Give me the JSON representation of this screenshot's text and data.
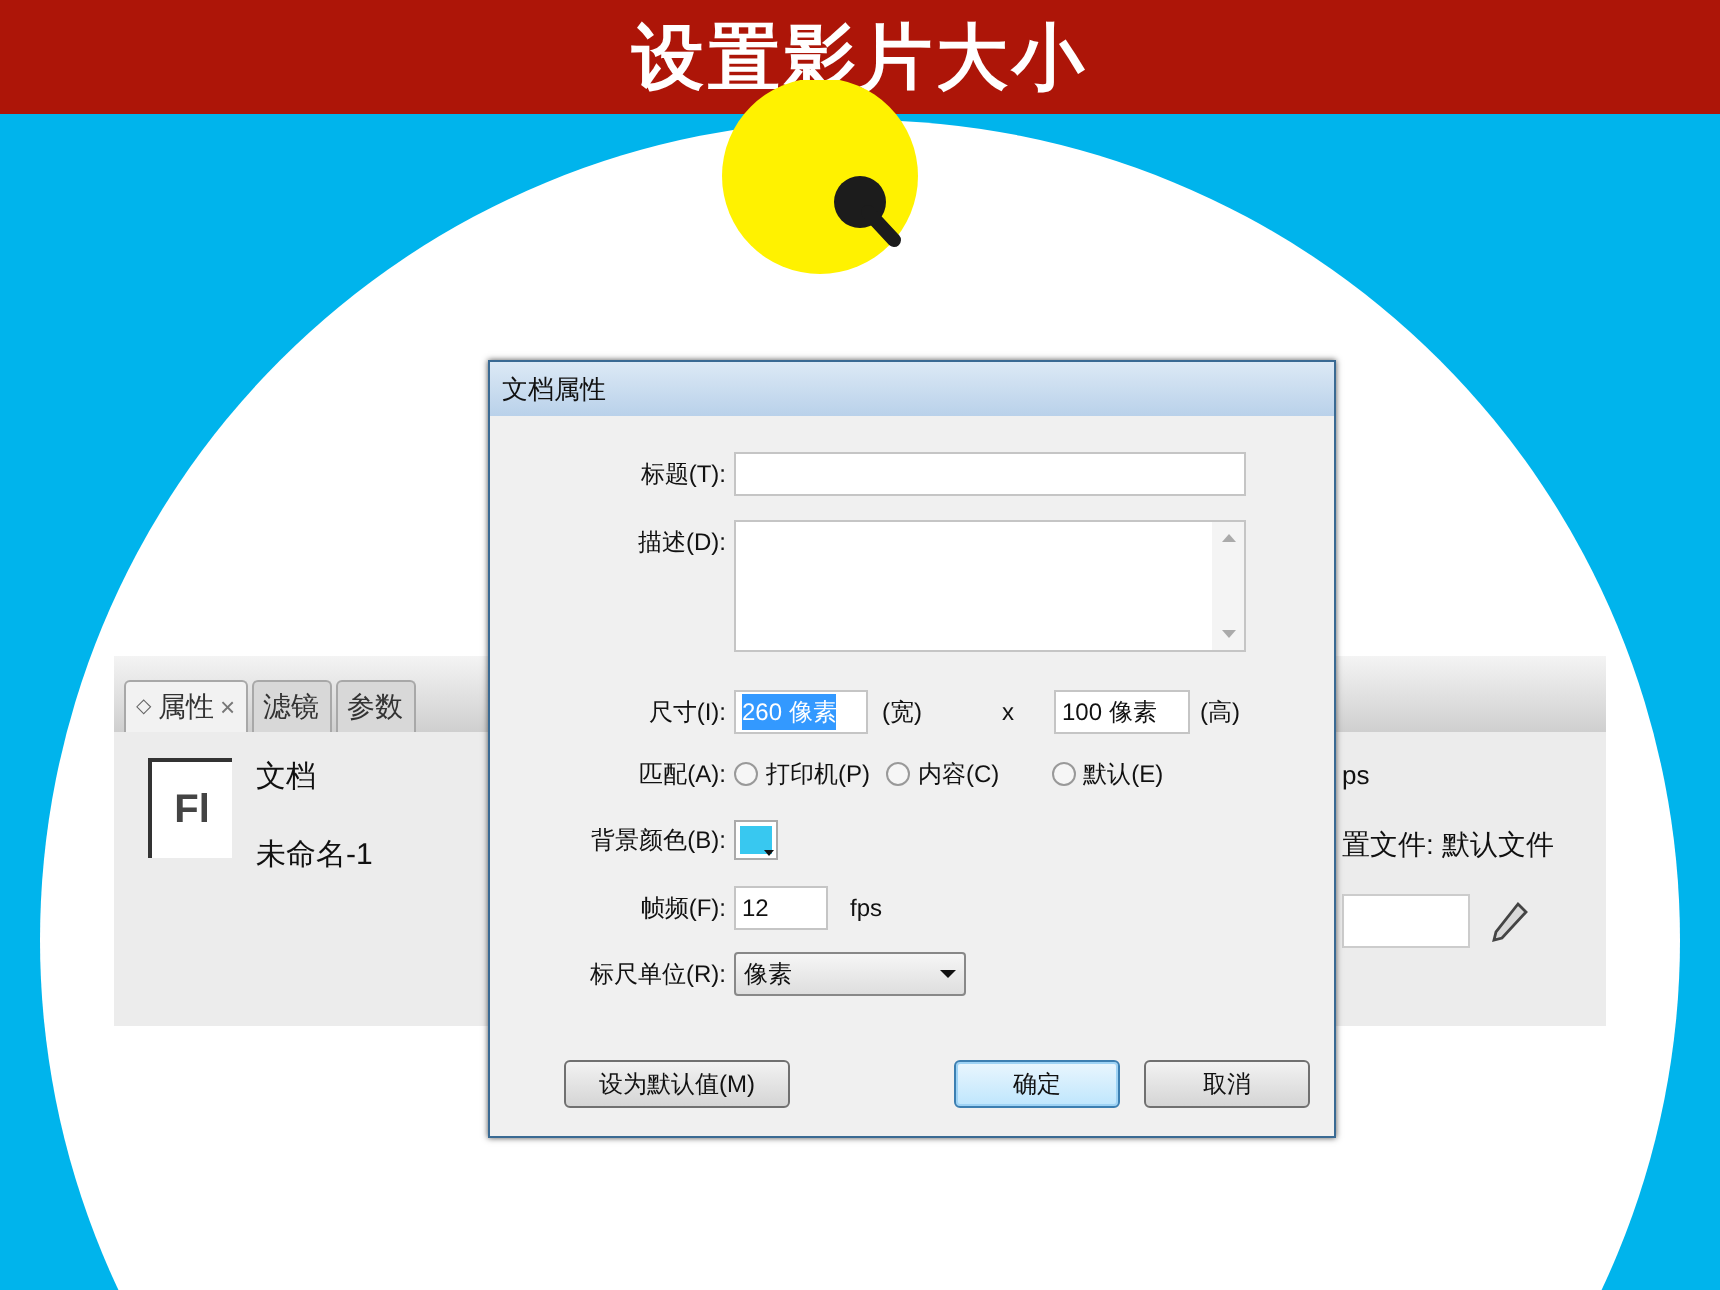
{
  "slide": {
    "title": "设置影片大小"
  },
  "panel": {
    "tabs": [
      {
        "marker": "◇",
        "label": "属性",
        "close": "×",
        "selected": true
      },
      {
        "label": "滤镜",
        "selected": false
      },
      {
        "label": "参数",
        "selected": false
      }
    ],
    "logo": "Fl",
    "doc_type": "文档",
    "doc_name": "未命名-1",
    "fps_fragment": "ps",
    "profile": "置文件: 默认文件"
  },
  "dialog": {
    "title": "文档属性",
    "title_label": "标题(T):",
    "description_label": "描述(D):",
    "size_label": "尺寸(I):",
    "width": {
      "value": "260 像素",
      "highlighted": true
    },
    "width_unit": "(宽)",
    "times": "x",
    "height": {
      "value": "100 像素",
      "highlighted": false
    },
    "height_unit": "(高)",
    "match_label": "匹配(A):",
    "match_options": [
      {
        "label": "打印机(P)",
        "selected": false
      },
      {
        "label": "内容(C)",
        "selected": false
      },
      {
        "label": "默认(E)",
        "selected": false
      }
    ],
    "bg_label": "背景颜色(B):",
    "fps_label": "帧频(F):",
    "fps": "12",
    "fps_unit": "fps",
    "ruler_label": "标尺单位(R):",
    "ruler": "像素",
    "buttons": [
      {
        "label": "设为默认值(M)",
        "kind": "secondary"
      },
      {
        "label": "确定",
        "kind": "default"
      },
      {
        "label": "取消",
        "kind": "secondary"
      }
    ]
  }
}
